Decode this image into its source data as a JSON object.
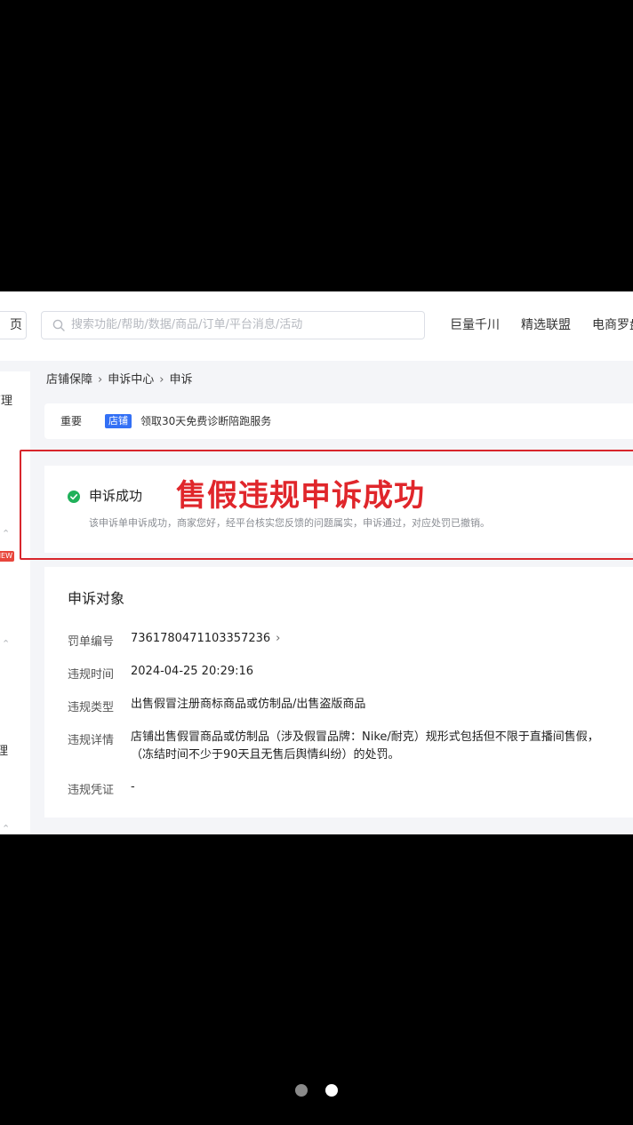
{
  "header": {
    "home_fragment": "页",
    "search_placeholder": "搜索功能/帮助/数据/商品/订单/平台消息/活动",
    "nav": [
      "巨量千川",
      "精选联盟",
      "电商罗盘"
    ]
  },
  "sidebar": {
    "fragments": [
      "管理",
      "",
      "NEW",
      "",
      "理"
    ]
  },
  "breadcrumb": [
    "店铺保障",
    "申诉中心",
    "申诉"
  ],
  "notice": {
    "label": "重要",
    "tag": "店铺",
    "text": "领取30天免费诊断陪跑服务"
  },
  "result": {
    "status": "申诉成功",
    "description": "该申诉单申诉成功，商家您好，经平台核实您反馈的问题属实，申诉通过，对应处罚已撤销。",
    "overlay_caption": "售假违规申诉成功"
  },
  "appeal_target": {
    "title": "申诉对象",
    "rows": [
      {
        "label": "罚单编号",
        "value": "7361780471103357236"
      },
      {
        "label": "违规时间",
        "value": "2024-04-25 20:29:16"
      },
      {
        "label": "违规类型",
        "value": "出售假冒注册商标商品或仿制品/出售盗版商品"
      },
      {
        "label": "违规详情",
        "value": "店铺出售假冒商品或仿制品（涉及假冒品牌：Nike/耐克）规形式包括但不限于直播间售假，",
        "value_line2": "（冻结时间不少于90天且无售后舆情纠纷）的处罚。"
      },
      {
        "label": "违规凭证",
        "value": "-"
      }
    ]
  },
  "pager": {
    "total": 2,
    "active": 2,
    "colors": {
      "inactive": "#8a8a8a",
      "active": "#ffffff"
    }
  },
  "colors": {
    "accent_blue": "#3370f5",
    "success_green": "#20b15a",
    "highlight_red": "#e0262b"
  }
}
